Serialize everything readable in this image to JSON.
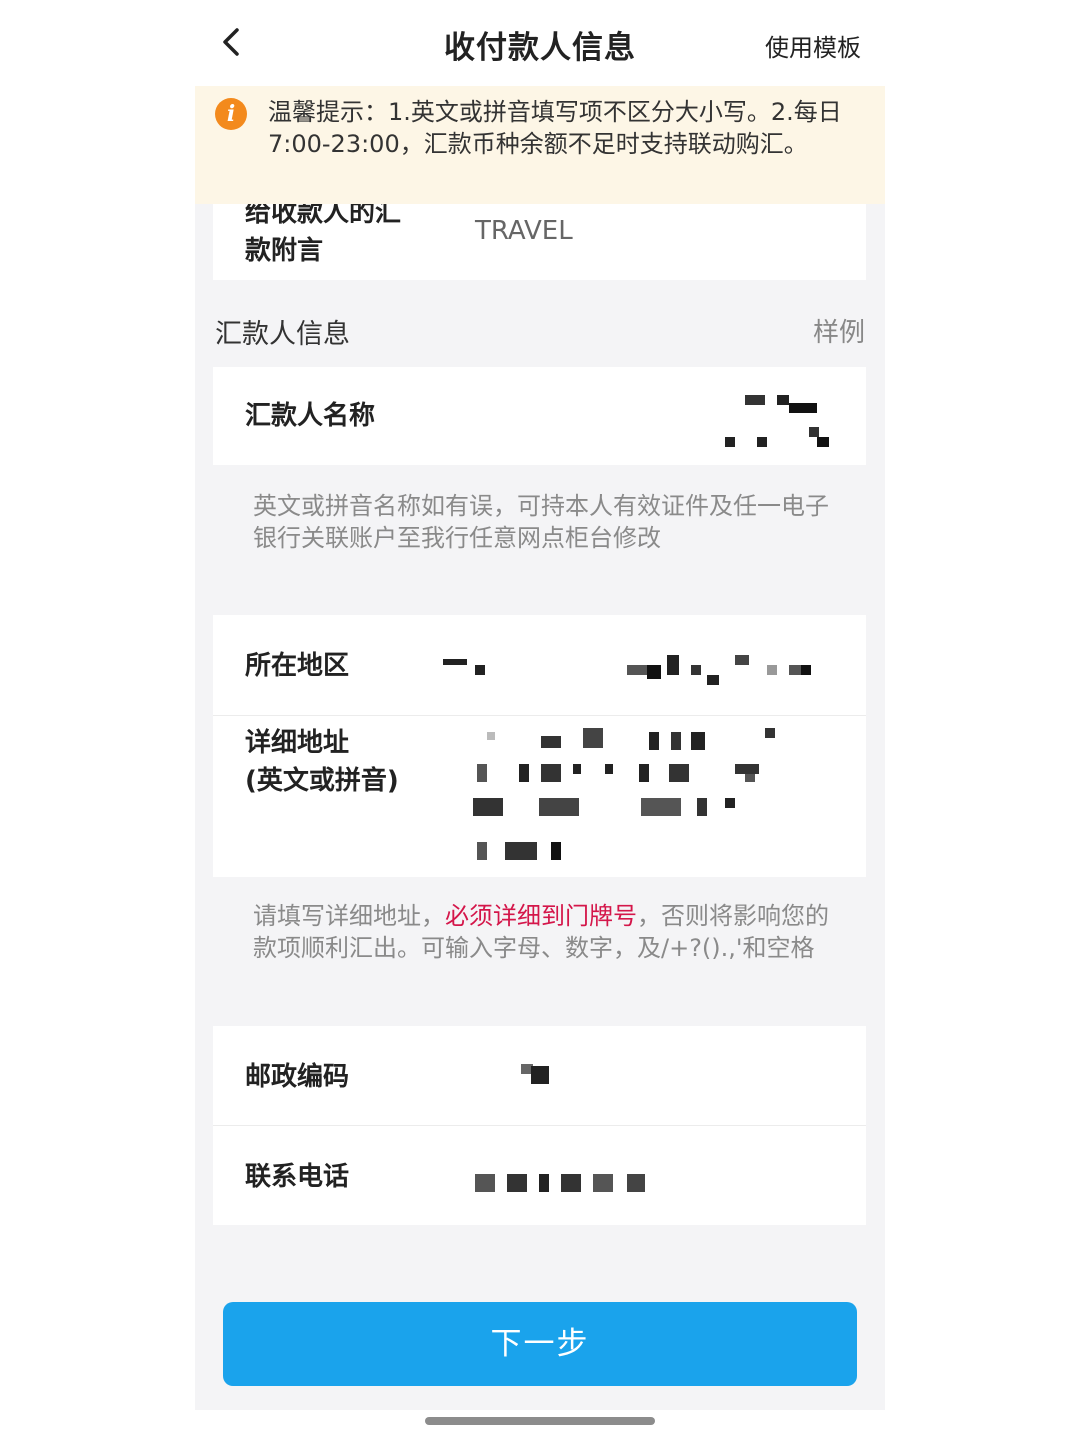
{
  "nav": {
    "title": "收付款人信息",
    "action": "使用模板"
  },
  "notice": {
    "icon": "info-icon",
    "text": "温馨提示：1.英文或拼音填写项不区分大小写。2.每日7:00-23:00，汇款币种余额不足时支持联动购汇。"
  },
  "remark": {
    "label_line1": "给收款人的汇",
    "label_line2": "款附言",
    "value": "TRAVEL"
  },
  "remitter_section": {
    "title": "汇款人信息",
    "example_link": "样例"
  },
  "remitter_name": {
    "label": "汇款人名称"
  },
  "name_hint": {
    "text": "英文或拼音名称如有误，可持本人有效证件及任一电子银行关联账户至我行任意网点柜台修改"
  },
  "region": {
    "label": "所在地区"
  },
  "address": {
    "label_line1": "详细地址",
    "label_line2": "(英文或拼音)"
  },
  "address_hint": {
    "prefix": "请填写详细地址，",
    "highlight": "必须详细到门牌号",
    "suffix": "，否则将影响您的款项顺利汇出。可输入字母、数字，及/+?().,'和空格"
  },
  "postcode": {
    "label": "邮政编码"
  },
  "phone": {
    "label": "联系电话"
  },
  "next_button": {
    "label": "下一步"
  },
  "colors": {
    "accent": "#1aa3ec",
    "notice_bg": "#fdf6e6",
    "notice_icon": "#f38a1d",
    "highlight": "#d4164a"
  }
}
